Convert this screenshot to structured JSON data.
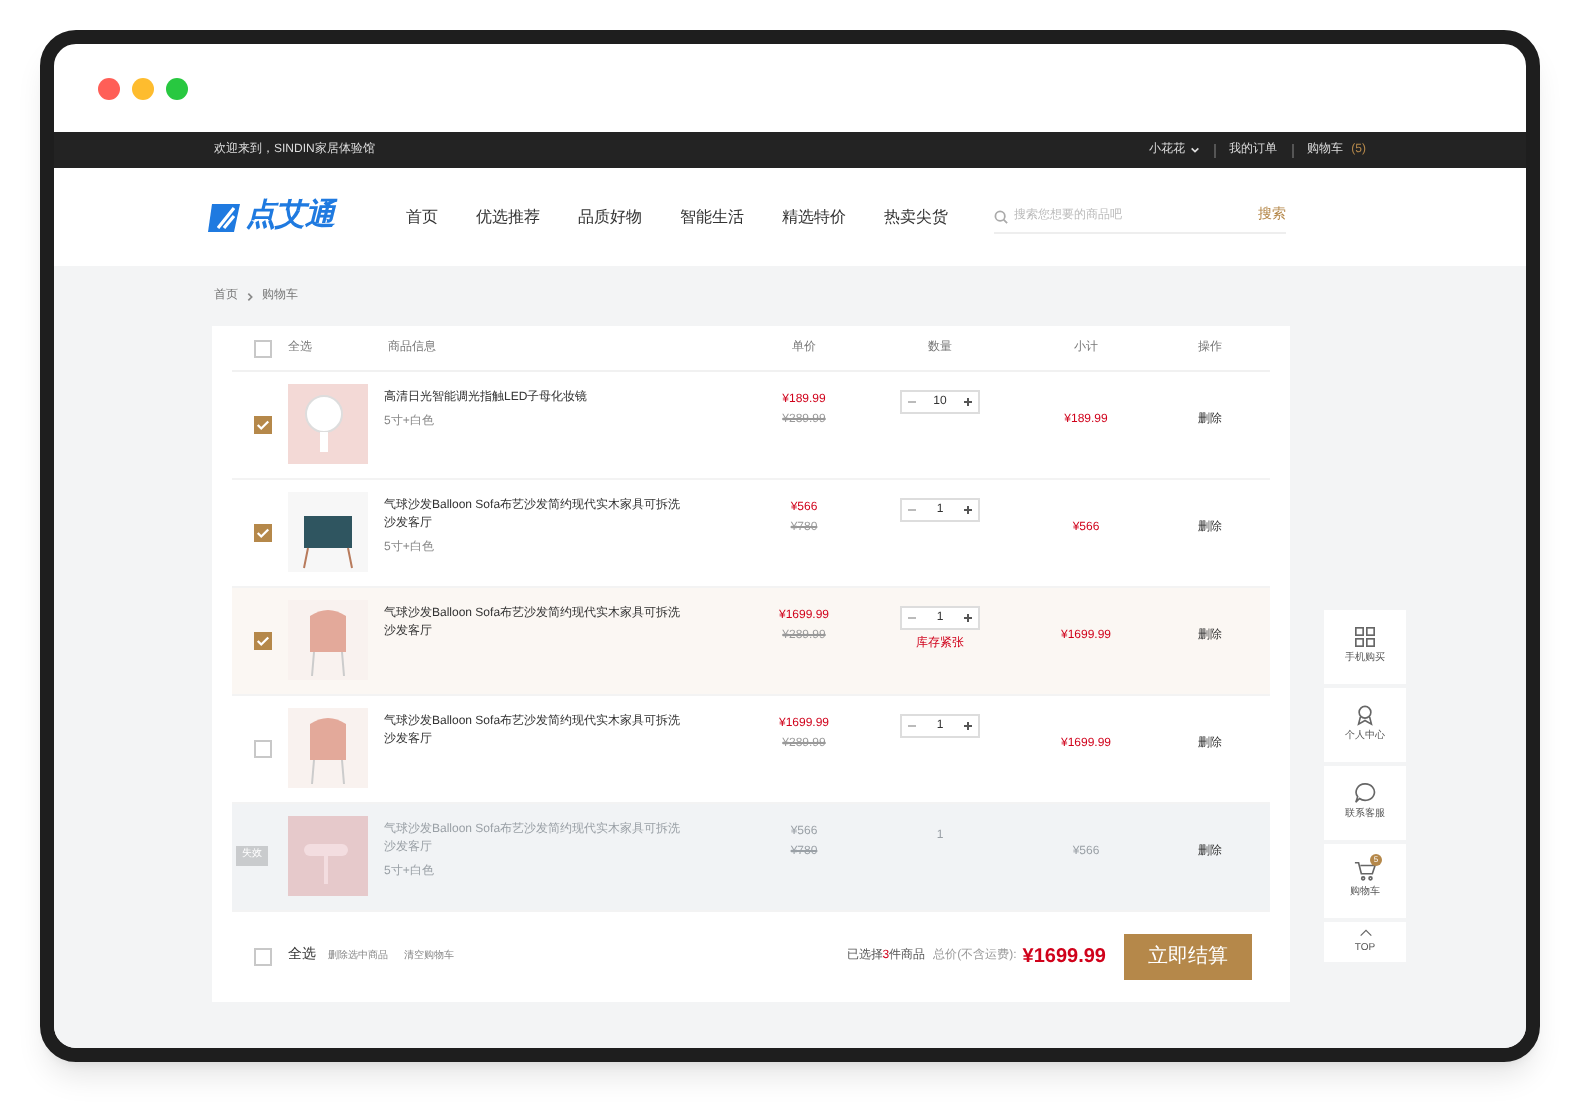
{
  "topbar": {
    "welcome": "欢迎来到，SINDIN家居体验馆",
    "user": "小花花",
    "links": [
      "我的订单"
    ],
    "cart_label": "购物车",
    "cart_count": "(5)"
  },
  "header": {
    "logo": "点艾通",
    "nav": [
      "首页",
      "优选推荐",
      "品质好物",
      "智能生活",
      "精选特价",
      "热卖尖货"
    ],
    "search_placeholder": "搜索您想要的商品吧",
    "search_button": "搜索"
  },
  "breadcrumb": [
    "首页",
    "购物车"
  ],
  "cart": {
    "select_all_checked": false,
    "columns": [
      "全选",
      "商品信息",
      "单价",
      "数量",
      "小计",
      "操作"
    ],
    "items": [
      {
        "kind": "normal",
        "checked": true,
        "highlighted": false,
        "title": "高清日光智能调光指触LED子母化妆镜",
        "spec": "5寸+白色",
        "price": "¥189.99",
        "original_price": "¥289.99",
        "quantity": "10",
        "subtotal": "¥189.99",
        "action": "删除"
      },
      {
        "kind": "normal",
        "checked": true,
        "highlighted": false,
        "title": "气球沙发Balloon Sofa布艺沙发简约现代实木家具可拆洗沙发客厅",
        "spec": "5寸+白色",
        "price": "¥566",
        "original_price": "¥780",
        "quantity": "1",
        "subtotal": "¥566",
        "action": "删除"
      },
      {
        "kind": "normal",
        "checked": true,
        "highlighted": true,
        "title": "气球沙发Balloon Sofa布艺沙发简约现代实木家具可拆洗沙发客厅",
        "price": "¥1699.99",
        "original_price": "¥289.99",
        "quantity": "1",
        "warning": "库存紧张",
        "subtotal": "¥1699.99",
        "action": "删除"
      },
      {
        "kind": "normal",
        "checked": false,
        "highlighted": false,
        "title": "气球沙发Balloon Sofa布艺沙发简约现代实木家具可拆洗沙发客厅",
        "price": "¥1699.99",
        "original_price": "¥289.99",
        "quantity": "1",
        "subtotal": "¥1699.99",
        "action": "删除"
      },
      {
        "kind": "invalid",
        "badge": "失效",
        "title": "气球沙发Balloon Sofa布艺沙发简约现代实木家具可拆洗沙发客厅",
        "spec": "5寸+白色",
        "price": "¥566",
        "original_price": "¥780",
        "quantity": "1",
        "subtotal": "¥566",
        "action": "删除"
      }
    ],
    "footer": {
      "select_all": "全选",
      "checked": false,
      "links": [
        "删除选中商品",
        "清空购物车"
      ],
      "selected_prefix": "已选择",
      "selected_count": "3",
      "selected_suffix": "件商品",
      "total_label": "总价(不含运费):",
      "total": "¥1699.99",
      "checkout": "立即结算"
    }
  },
  "sidebar": [
    {
      "kind": "grid",
      "label": "手机购买"
    },
    {
      "kind": "user",
      "label": "个人中心"
    },
    {
      "kind": "chat",
      "label": "联系客服"
    },
    {
      "kind": "cart",
      "label": "购物车",
      "badge": "5"
    },
    {
      "kind": "top",
      "label": "TOP"
    }
  ]
}
